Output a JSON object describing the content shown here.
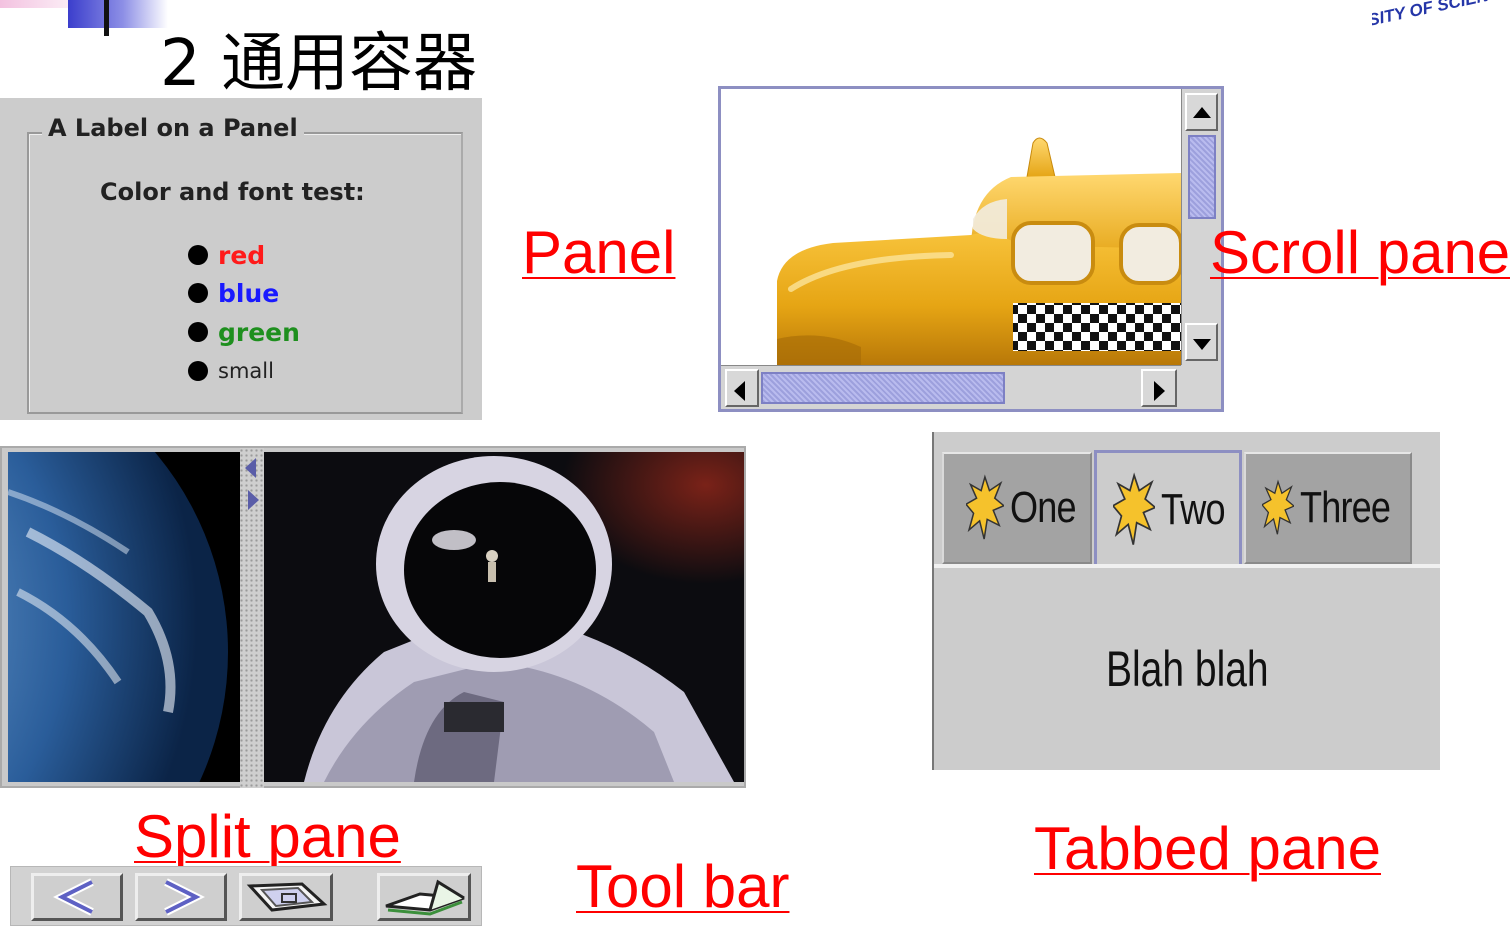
{
  "slide": {
    "title": "2 通用容器",
    "seal_text": "SITY OF SCIENC"
  },
  "captions": {
    "panel": "Panel",
    "scroll_pane": "Scroll pane",
    "split_pane": "Split pane",
    "tabbed_pane": "Tabbed pane",
    "tool_bar": "Tool bar"
  },
  "panel_demo": {
    "border_title": "A Label on a Panel",
    "heading": "Color and font test:",
    "items": [
      {
        "label": "red",
        "color": "#ff1a1a"
      },
      {
        "label": "blue",
        "color": "#1a1aff"
      },
      {
        "label": "green",
        "color": "#1e8f1e"
      },
      {
        "label": "small",
        "color": "#222222"
      }
    ]
  },
  "scroll_demo": {
    "image": "yellow-taxi-image",
    "vertical_scroll_fraction": 0.0,
    "horizontal_scroll_fraction": 0.0
  },
  "split_demo": {
    "left_image": "earth-image",
    "right_image": "astronaut-image"
  },
  "tabbed_demo": {
    "tabs": [
      {
        "label": "One",
        "selected": false
      },
      {
        "label": "Two",
        "selected": true
      },
      {
        "label": "Three",
        "selected": false
      }
    ],
    "content": "Blah blah"
  },
  "toolbar_demo": {
    "buttons": [
      "left-arrow-icon",
      "right-arrow-icon",
      "frame-icon",
      "tray-icon"
    ]
  },
  "colors": {
    "caption": "#ff0000",
    "java_purple": "#8d8fc2"
  }
}
